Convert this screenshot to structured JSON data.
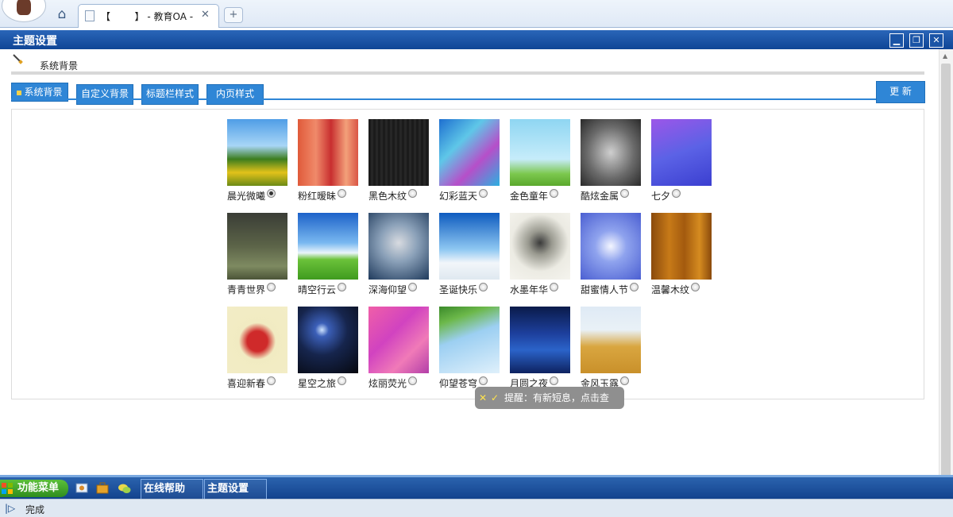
{
  "browser": {
    "tab_title": "【        】 - 教育OA - ",
    "close_glyph": "✕",
    "newtab_glyph": "+",
    "home_glyph": "⌂"
  },
  "window": {
    "title": "主题设置",
    "min_glyph": "▁",
    "restore_glyph": "❐",
    "close_glyph": "✕"
  },
  "section": {
    "title": "系统背景"
  },
  "subtabs": [
    {
      "label": "系统背景",
      "active": true
    },
    {
      "label": "自定义背景",
      "active": false
    },
    {
      "label": "标题栏样式",
      "active": false
    },
    {
      "label": "内页样式",
      "active": false
    }
  ],
  "update_label": "更 新",
  "backgrounds": [
    {
      "label": "晨光微曦",
      "selected": true
    },
    {
      "label": "粉红暧昧",
      "selected": false
    },
    {
      "label": "黑色木纹",
      "selected": false
    },
    {
      "label": "幻彩蓝天",
      "selected": false
    },
    {
      "label": "金色童年",
      "selected": false
    },
    {
      "label": "酷炫金属",
      "selected": false
    },
    {
      "label": "七夕",
      "selected": false
    },
    {
      "label": "青青世界",
      "selected": false
    },
    {
      "label": "晴空行云",
      "selected": false
    },
    {
      "label": "深海仰望",
      "selected": false
    },
    {
      "label": "圣诞快乐",
      "selected": false
    },
    {
      "label": "水墨年华",
      "selected": false
    },
    {
      "label": "甜蜜情人节",
      "selected": false
    },
    {
      "label": "温馨木纹",
      "selected": false
    },
    {
      "label": "喜迎新春",
      "selected": false
    },
    {
      "label": "星空之旅",
      "selected": false
    },
    {
      "label": "炫丽荧光",
      "selected": false
    },
    {
      "label": "仰望苍穹",
      "selected": false
    },
    {
      "label": "月圆之夜",
      "selected": false
    },
    {
      "label": "金风玉露",
      "selected": false
    }
  ],
  "notification": {
    "x": "✕",
    "check": "✓",
    "message": "提醒：有新短息，点击查看！"
  },
  "taskbar": {
    "func_menu": "功能菜单",
    "tasks": [
      {
        "label": "在线帮助"
      },
      {
        "label": "主题设置"
      }
    ]
  },
  "status": {
    "icon_glyph": "|▷",
    "text": "完成"
  },
  "colors": {
    "accent": "#2f86d6",
    "titlebar": "#1a54a6",
    "taskbar": "#103f8a"
  }
}
